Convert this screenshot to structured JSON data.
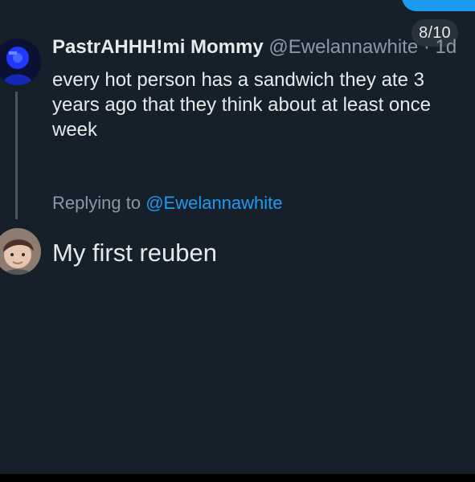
{
  "colors": {
    "background": "#15202b",
    "primary_text": "#e7e9ea",
    "secondary_text": "#8b98a5",
    "accent": "#1d9bf0",
    "thread_line": "#4a5561"
  },
  "page_indicator": {
    "text": "8/10"
  },
  "original_tweet": {
    "display_name": "PastrAHHH!mi Mommy",
    "handle": "@Ewelannawhite",
    "separator": "·",
    "time": "1d",
    "text": "every hot person has a sandwich they ate 3\nyears ago that they think about at least once\nweek"
  },
  "reply": {
    "replying_prefix": "Replying to",
    "replying_handle": "@Ewelannawhite",
    "text": "My first reuben"
  },
  "icons": {
    "original_avatar": "avatar-icon",
    "reply_avatar": "avatar-icon"
  }
}
